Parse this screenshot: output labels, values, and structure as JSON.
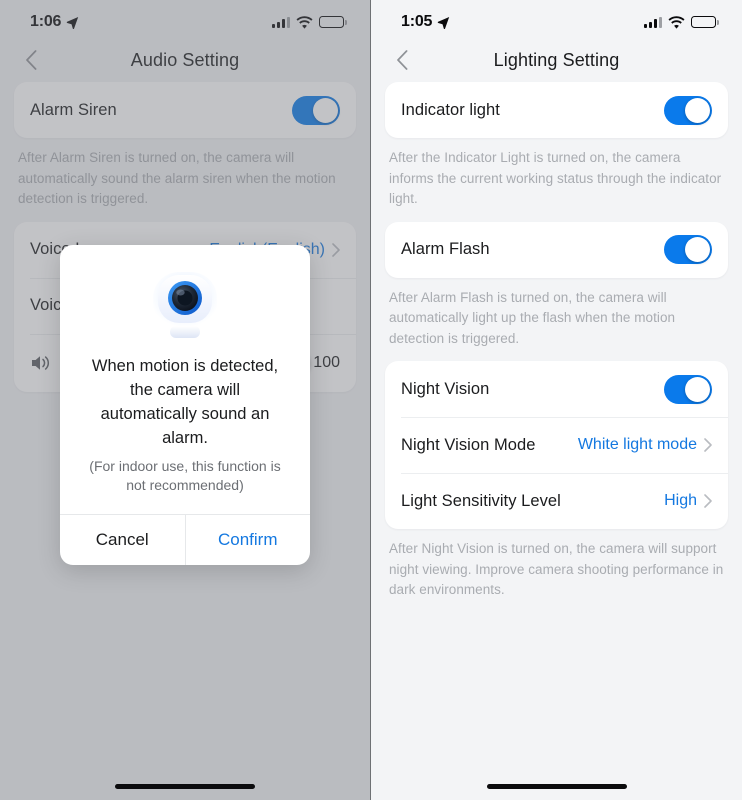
{
  "left_screen": {
    "status": {
      "time": "1:06",
      "location_icon": "location-arrow-icon",
      "signal_icon": "cellular-bars-icon",
      "wifi_icon": "wifi-icon",
      "battery_icon": "battery-icon"
    },
    "nav": {
      "back_icon": "chevron-left-icon",
      "title": "Audio Setting"
    },
    "alarm_siren": {
      "label": "Alarm Siren",
      "toggle_on": true,
      "description": "After Alarm Siren is turned on, the camera will automatically sound the alarm siren when the motion detection is triggered."
    },
    "voice_language": {
      "label": "Voice Language",
      "value": "English(English)",
      "chevron_icon": "chevron-right-icon"
    },
    "voice_volume": {
      "label": "Voic",
      "speaker_icon": "speaker-icon",
      "value": "100"
    },
    "dialog": {
      "icon": "camera-icon",
      "title": "When motion is detected, the camera will automatically sound an alarm.",
      "subtitle": "(For indoor use, this function is not recommended)",
      "cancel_label": "Cancel",
      "confirm_label": "Confirm"
    }
  },
  "right_screen": {
    "status": {
      "time": "1:05",
      "location_icon": "location-arrow-icon",
      "signal_icon": "cellular-bars-icon",
      "wifi_icon": "wifi-icon",
      "battery_icon": "battery-icon"
    },
    "nav": {
      "back_icon": "chevron-left-icon",
      "title": "Lighting Setting"
    },
    "indicator_light": {
      "label": "Indicator light",
      "toggle_on": true,
      "description": "After the Indicator Light is turned on, the camera informs the current working status through the indicator light."
    },
    "alarm_flash": {
      "label": "Alarm Flash",
      "toggle_on": true,
      "description": "After Alarm Flash is turned on, the camera will automatically light up the flash when the motion detection is triggered."
    },
    "night_vision": {
      "label": "Night Vision",
      "toggle_on": true
    },
    "night_vision_mode": {
      "label": "Night Vision Mode",
      "value": "White light mode",
      "chevron_icon": "chevron-right-icon"
    },
    "light_sensitivity": {
      "label": "Light Sensitivity Level",
      "value": "High",
      "chevron_icon": "chevron-right-icon"
    },
    "night_vision_description": "After Night Vision is turned on, the camera will support night viewing. Improve camera shooting performance in dark environments."
  },
  "colors": {
    "accent": "#0a7aeb",
    "link": "#1478e0",
    "text": "#1b1c1e",
    "muted": "#a9acb1",
    "card": "#ffffff",
    "page_bg": "#f3f4f6"
  }
}
